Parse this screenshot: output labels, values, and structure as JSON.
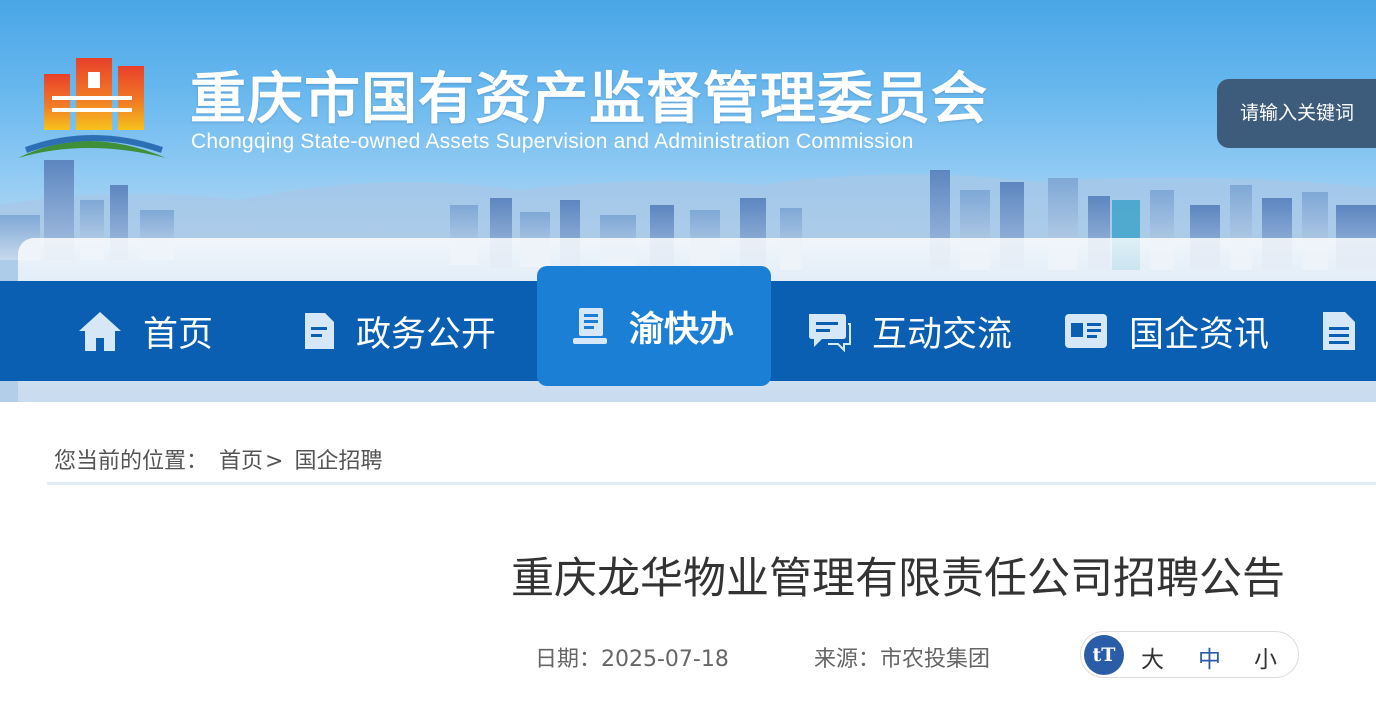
{
  "header": {
    "title": "重庆市国有资产监督管理委员会",
    "subtitle": "Chongqing State-owned Assets Supervision and Administration Commission",
    "search_placeholder": "请输入关键词"
  },
  "nav": {
    "items": [
      {
        "label": "首页",
        "icon": "home-icon"
      },
      {
        "label": "政务公开",
        "icon": "document-icon"
      },
      {
        "label": "渝快办",
        "icon": "book-stand-icon",
        "active": true
      },
      {
        "label": "互动交流",
        "icon": "chat-icon"
      },
      {
        "label": "国企资讯",
        "icon": "id-card-icon"
      },
      {
        "label": "",
        "icon": "file-list-icon"
      }
    ]
  },
  "breadcrumb": {
    "prefix": "您当前的位置：",
    "home": "首页",
    "separator": ">",
    "current": "国企招聘"
  },
  "article": {
    "title": "重庆龙华物业管理有限责任公司招聘公告",
    "date": "日期：2025-07-18",
    "source": "来源：市农投集团"
  },
  "font_size_control": {
    "icon_glyph": "tT",
    "options": [
      "大",
      "中",
      "小"
    ],
    "selected": "中"
  },
  "colors": {
    "nav_bg": "#0a5fb3",
    "nav_active_bg": "#1b7fd6",
    "search_bg": "#3d5c7c",
    "accent": "#2a5ca8"
  }
}
